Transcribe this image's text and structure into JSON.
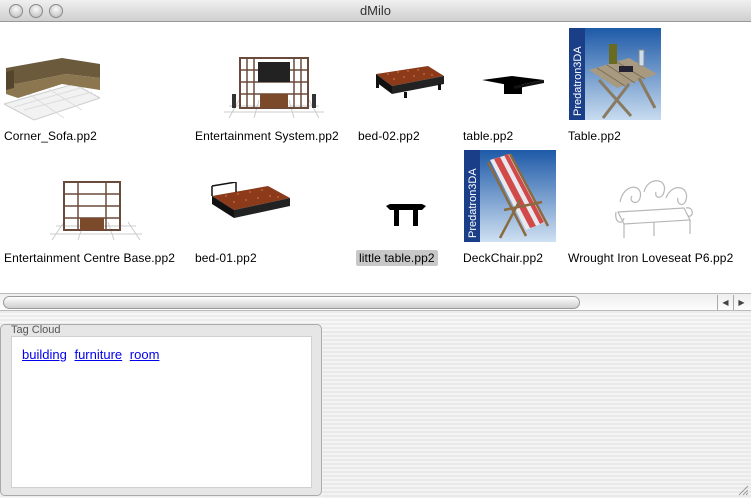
{
  "window": {
    "title": "dMilo"
  },
  "files": [
    {
      "name": "Corner_Sofa.pp2",
      "thumb": "corner-sofa-thumbnail",
      "selected": false
    },
    {
      "name": "Entertainment System.pp2",
      "thumb": "entertainment-system-thumbnail",
      "selected": false
    },
    {
      "name": "bed-02.pp2",
      "thumb": "bed-thumbnail",
      "selected": false
    },
    {
      "name": "table.pp2",
      "thumb": "table-thumbnail",
      "selected": false
    },
    {
      "name": "Table.pp2",
      "thumb": "predatron-table-thumbnail",
      "selected": false,
      "brand": "Predatron3DA"
    },
    {
      "name": "Entertainment Centre Base.pp2",
      "thumb": "entertainment-centre-base-thumbnail",
      "selected": false
    },
    {
      "name": "bed-01.pp2",
      "thumb": "bed-thumbnail",
      "selected": false
    },
    {
      "name": "little table.pp2",
      "thumb": "little-table-thumbnail",
      "selected": true
    },
    {
      "name": "DeckChair.pp2",
      "thumb": "predatron-deckchair-thumbnail",
      "selected": false,
      "brand": "Predatron3DA"
    },
    {
      "name": "Wrought Iron Loveseat P6.pp2",
      "thumb": "loveseat-thumbnail",
      "selected": false
    }
  ],
  "tag_cloud": {
    "title": "Tag Cloud",
    "tags": [
      "building",
      "furniture",
      "room"
    ]
  },
  "scrollbar": {
    "left_arrow": "◀",
    "right_arrow": "▶"
  },
  "colors": {
    "link": "#0000ee",
    "selection": "#c8c8c8"
  }
}
